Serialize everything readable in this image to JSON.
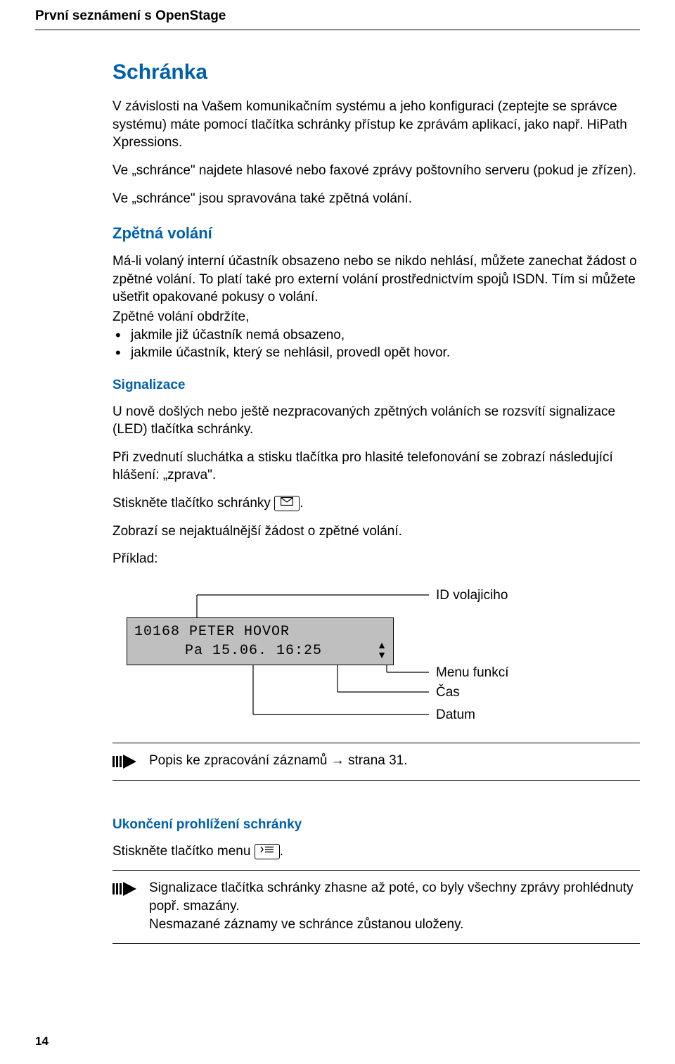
{
  "header": "První seznámení s OpenStage",
  "h1": "Schránka",
  "p1": "V závislosti na Vašem komunikačním systému a jeho konfiguraci (zeptejte se správce systému) máte pomocí tlačítka schránky přístup ke zprávám aplikací, jako např. HiPath Xpressions.",
  "p2": "Ve „schránce\" najdete hlasové nebo faxové zprávy poštovního serveru (pokud je zřízen).",
  "p3": "Ve „schránce\" jsou spravována také zpětná volání.",
  "h2": "Zpětná volání",
  "p4": "Má-li volaný interní účastník obsazeno nebo se nikdo nehlásí, můžete zanechat žádost o zpětné volání. To platí také pro externí volání prostřednictvím spojů ISDN. Tím si můžete ušetřit opakované pokusy o volání.",
  "p5": "Zpětné volání obdržíte,",
  "bullets": [
    "jakmile již účastník nemá obsazeno,",
    "jakmile účastník, který se nehlásil, provedl opět hovor."
  ],
  "h3": "Signalizace",
  "p6": "U nově došlých nebo ještě nezpracovaných zpětných voláních se rozsvítí signalizace (LED) tlačítka schránky.",
  "p7": "Při zvednutí sluchátka a stisku tlačítka pro hlasité telefonování se zobrazí následující hlášení: „zprava\".",
  "p8a": "Stiskněte tlačítko schránky ",
  "p8b": ".",
  "p9": "Zobrazí se nejaktuálnější žádost o zpětné volání.",
  "p10": "Příklad:",
  "display": {
    "line1": "10168 PETER HOVOR",
    "line2": "Pa 15.06. 16:25"
  },
  "labels": {
    "id": "ID volajiciho",
    "menu": "Menu funkcí",
    "cas": "Čas",
    "datum": "Datum"
  },
  "note1_a": "Popis ke zpracování záznamů ",
  "note1_b": " strana 31.",
  "h4": "Ukončení prohlížení schránky",
  "p11a": "Stiskněte tlačítko menu ",
  "p11b": ".",
  "note2": "Signalizace tlačítka schránky zhasne až poté, co byly všechny zprávy prohlédnuty popř. smazány.\nNesmazané záznamy ve schránce zůstanou uloženy.",
  "arrow": "→",
  "page_number": "14"
}
